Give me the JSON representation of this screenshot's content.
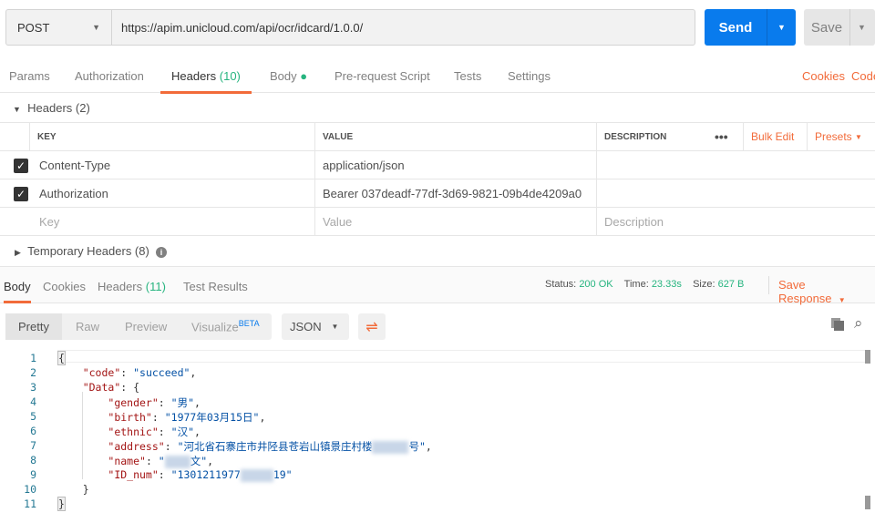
{
  "request": {
    "method": "POST",
    "url": "https://apim.unicloud.com/api/ocr/idcard/1.0.0/",
    "send": "Send",
    "save": "Save"
  },
  "tabs": [
    "Params",
    "Authorization",
    "Headers",
    "(10)",
    "Body",
    "Pre-request Script",
    "Tests",
    "Settings"
  ],
  "tab_right": [
    "Cookies",
    "Code"
  ],
  "headers_section": "Headers (2)",
  "table": {
    "cols": [
      "KEY",
      "VALUE",
      "DESCRIPTION"
    ],
    "bulk_edit": "Bulk Edit",
    "presets": "Presets",
    "rows": [
      {
        "key": "Content-Type",
        "value": "application/json"
      },
      {
        "key": "Authorization",
        "value": "Bearer 037deadf-77df-3d69-9821-09b4de4209a0"
      }
    ],
    "placeholders": {
      "key": "Key",
      "value": "Value",
      "description": "Description"
    }
  },
  "temp_headers": "Temporary Headers (8)",
  "response": {
    "tabs": [
      "Body",
      "Cookies",
      "Headers",
      "(11)",
      "Test Results"
    ],
    "status_label": "Status:",
    "status": "200 OK",
    "time_label": "Time:",
    "time": "23.33s",
    "size_label": "Size:",
    "size": "627 B",
    "save_response": "Save Response",
    "views": [
      "Pretty",
      "Raw",
      "Preview",
      "Visualize",
      "BETA"
    ],
    "format": "JSON"
  },
  "code": {
    "l2k": "\"code\"",
    "l2v": "\"succeed\"",
    "l3k": "\"Data\"",
    "l4k": "\"gender\"",
    "l4v": "\"男\"",
    "l5k": "\"birth\"",
    "l5v": "\"1977年03月15日\"",
    "l6k": "\"ethnic\"",
    "l6v": "\"汉\"",
    "l7k": "\"address\"",
    "l7v": "\"河北省石寨庄市井陉县苍岩山镇景庄村楼",
    "l7v2": "号\"",
    "l8k": "\"name\"",
    "l8v": "\"",
    "l8v2": "文\"",
    "l9k": "\"ID_num\"",
    "l9v": "\"1301211977",
    "l9v2": "19\""
  }
}
